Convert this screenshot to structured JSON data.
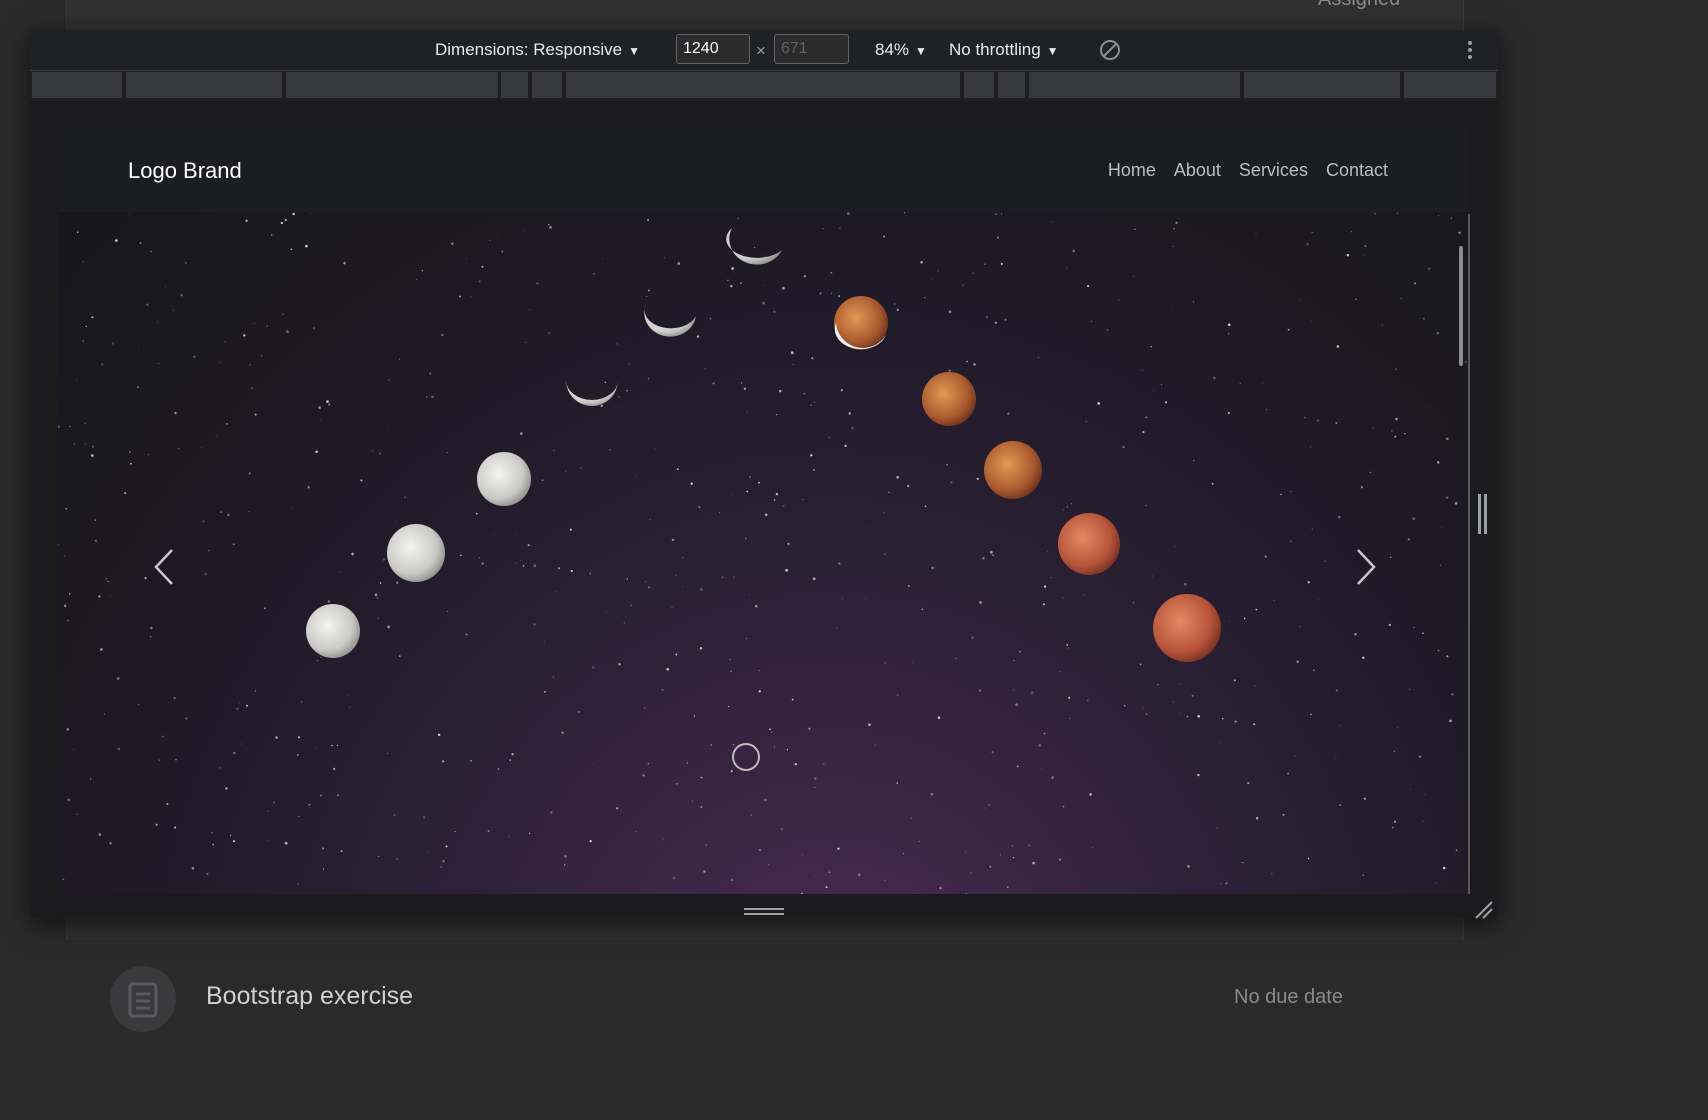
{
  "background_page": {
    "assigned_label": "Assigned",
    "assignment": {
      "title": "Bootstrap exercise",
      "due": "No due date",
      "icon": "assignment-icon"
    }
  },
  "devtools_toolbar": {
    "dimensions_label": "Dimensions: Responsive",
    "width_value": "1240",
    "height_placeholder": "671",
    "times_symbol": "×",
    "zoom_label": "84%",
    "throttling_label": "No throttling",
    "rotate_icon": "rotate-icon",
    "menu_icon": "more-vertical-icon"
  },
  "site": {
    "brand": "Logo Brand",
    "nav": [
      {
        "label": "Home"
      },
      {
        "label": "About"
      },
      {
        "label": "Services"
      },
      {
        "label": "Contact"
      }
    ],
    "carousel": {
      "prev_icon": "chevron-left-icon",
      "next_icon": "chevron-right-icon",
      "slide_count": 1,
      "active_index": 0
    }
  },
  "colors": {
    "devtools_bg": "#202124",
    "page_bg": "#2a2a2a",
    "navbar_bg": "#1c1d22",
    "sky_purple": "#4a2c55"
  }
}
